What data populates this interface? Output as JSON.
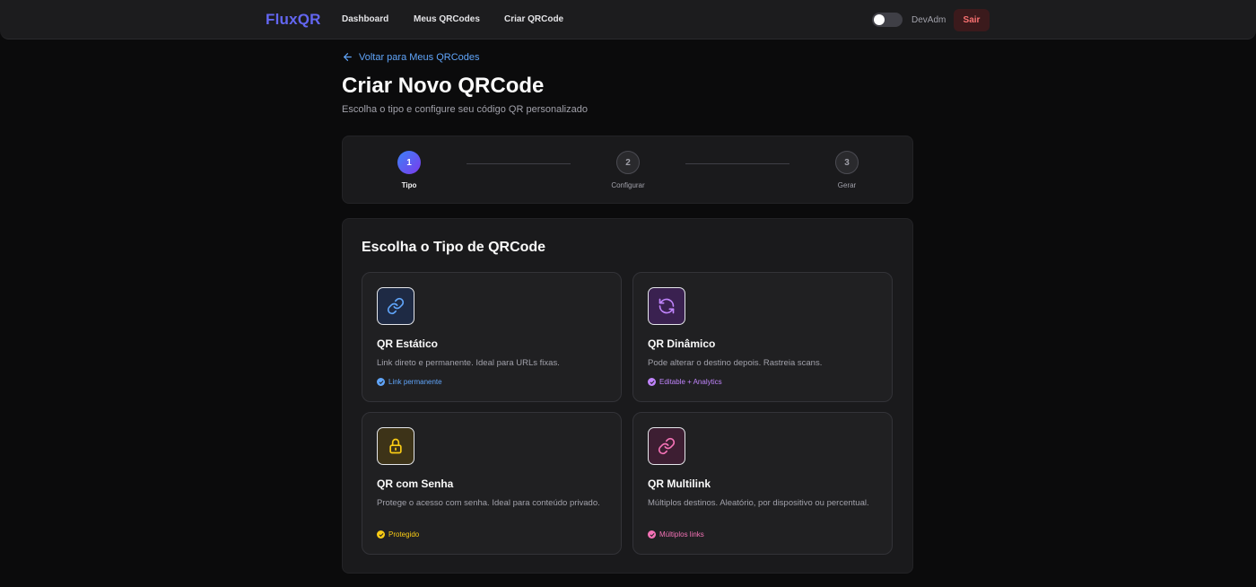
{
  "header": {
    "logo": "FluxQR",
    "nav": [
      "Dashboard",
      "Meus QRCodes",
      "Criar QRCode"
    ],
    "user": "DevAdm",
    "logout_label": "Sair"
  },
  "back_link": "Voltar para Meus QRCodes",
  "page": {
    "title": "Criar Novo QRCode",
    "subtitle": "Escolha o tipo e configure seu código QR personalizado"
  },
  "stepper": {
    "steps": [
      {
        "number": "1",
        "label": "Tipo",
        "active": true
      },
      {
        "number": "2",
        "label": "Configurar",
        "active": false
      },
      {
        "number": "3",
        "label": "Gerar",
        "active": false
      }
    ]
  },
  "types_panel": {
    "title": "Escolha o Tipo de QRCode",
    "cards": [
      {
        "title": "QR Estático",
        "description": "Link direto e permanente. Ideal para URLs fixas.",
        "badge": "Link permanente",
        "icon": "link-icon",
        "color": "#60a5fa",
        "bg": "#1e2a44"
      },
      {
        "title": "QR Dinâmico",
        "description": "Pode alterar o destino depois. Rastreia scans.",
        "badge": "Editable + Analytics",
        "icon": "refresh-icon",
        "color": "#c084fc",
        "bg": "#3a2150"
      },
      {
        "title": "QR com Senha",
        "description": "Protege o acesso com senha. Ideal para conteúdo privado.",
        "badge": "Protegido",
        "icon": "lock-icon",
        "color": "#facc15",
        "bg": "#3d3318"
      },
      {
        "title": "QR Multilink",
        "description": "Múltiplos destinos. Aleatório, por dispositivo ou percentual.",
        "badge": "Múltiplos links",
        "icon": "multilink-icon",
        "color": "#f472b6",
        "bg": "#3d1e32"
      }
    ]
  }
}
